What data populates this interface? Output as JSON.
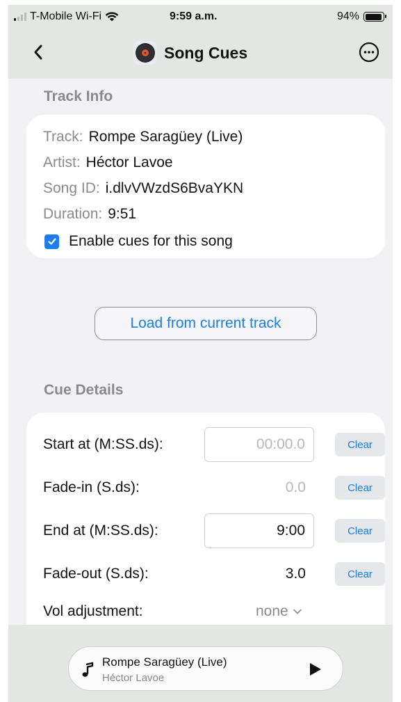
{
  "status_bar": {
    "carrier": "T-Mobile Wi-Fi",
    "time": "9:59 a.m.",
    "battery": "94%",
    "battery_level": 0.94
  },
  "nav": {
    "title": "Song Cues",
    "back_icon": "chevron-left-icon",
    "more_icon": "ellipsis-circle-icon",
    "app_icon": "vinyl-record-icon"
  },
  "track_info": {
    "header": "Track Info",
    "track_label": "Track:",
    "track_value": "Rompe Saragüey (Live)",
    "artist_label": "Artist:",
    "artist_value": "Héctor Lavoe",
    "song_id_label": "Song ID:",
    "song_id_value": "i.dlvVWzdS6BvaYKN",
    "duration_label": "Duration:",
    "duration_value": "9:51",
    "enable_cues_label": "Enable cues for this song",
    "enable_cues_checked": true
  },
  "load_button_label": "Load from current track",
  "cue_details": {
    "header": "Cue Details",
    "start_label": "Start at (M:SS.ds):",
    "start_placeholder": "00:00.0",
    "start_value": "",
    "fade_in_label": "Fade-in (S.ds):",
    "fade_in_placeholder": "0.0",
    "fade_in_value": "",
    "end_label": "End at (M:SS.ds):",
    "end_value": "9:00",
    "fade_out_label": "Fade-out (S.ds):",
    "fade_out_value": "3.0",
    "vol_label": "Vol adjustment:",
    "vol_value": "none",
    "clear_label": "Clear"
  },
  "mini_player": {
    "title": "Rompe Saragüey (Live)",
    "artist": "Héctor Lavoe",
    "play_icon": "play-icon",
    "note_icon": "music-note-icon"
  },
  "colors": {
    "accent": "#1a7fe6",
    "checkbox": "#1e7cf0",
    "secondary_text": "#8a8a8e",
    "bar_background": "#e4e6e4",
    "page_background": "#f2f2f4"
  }
}
